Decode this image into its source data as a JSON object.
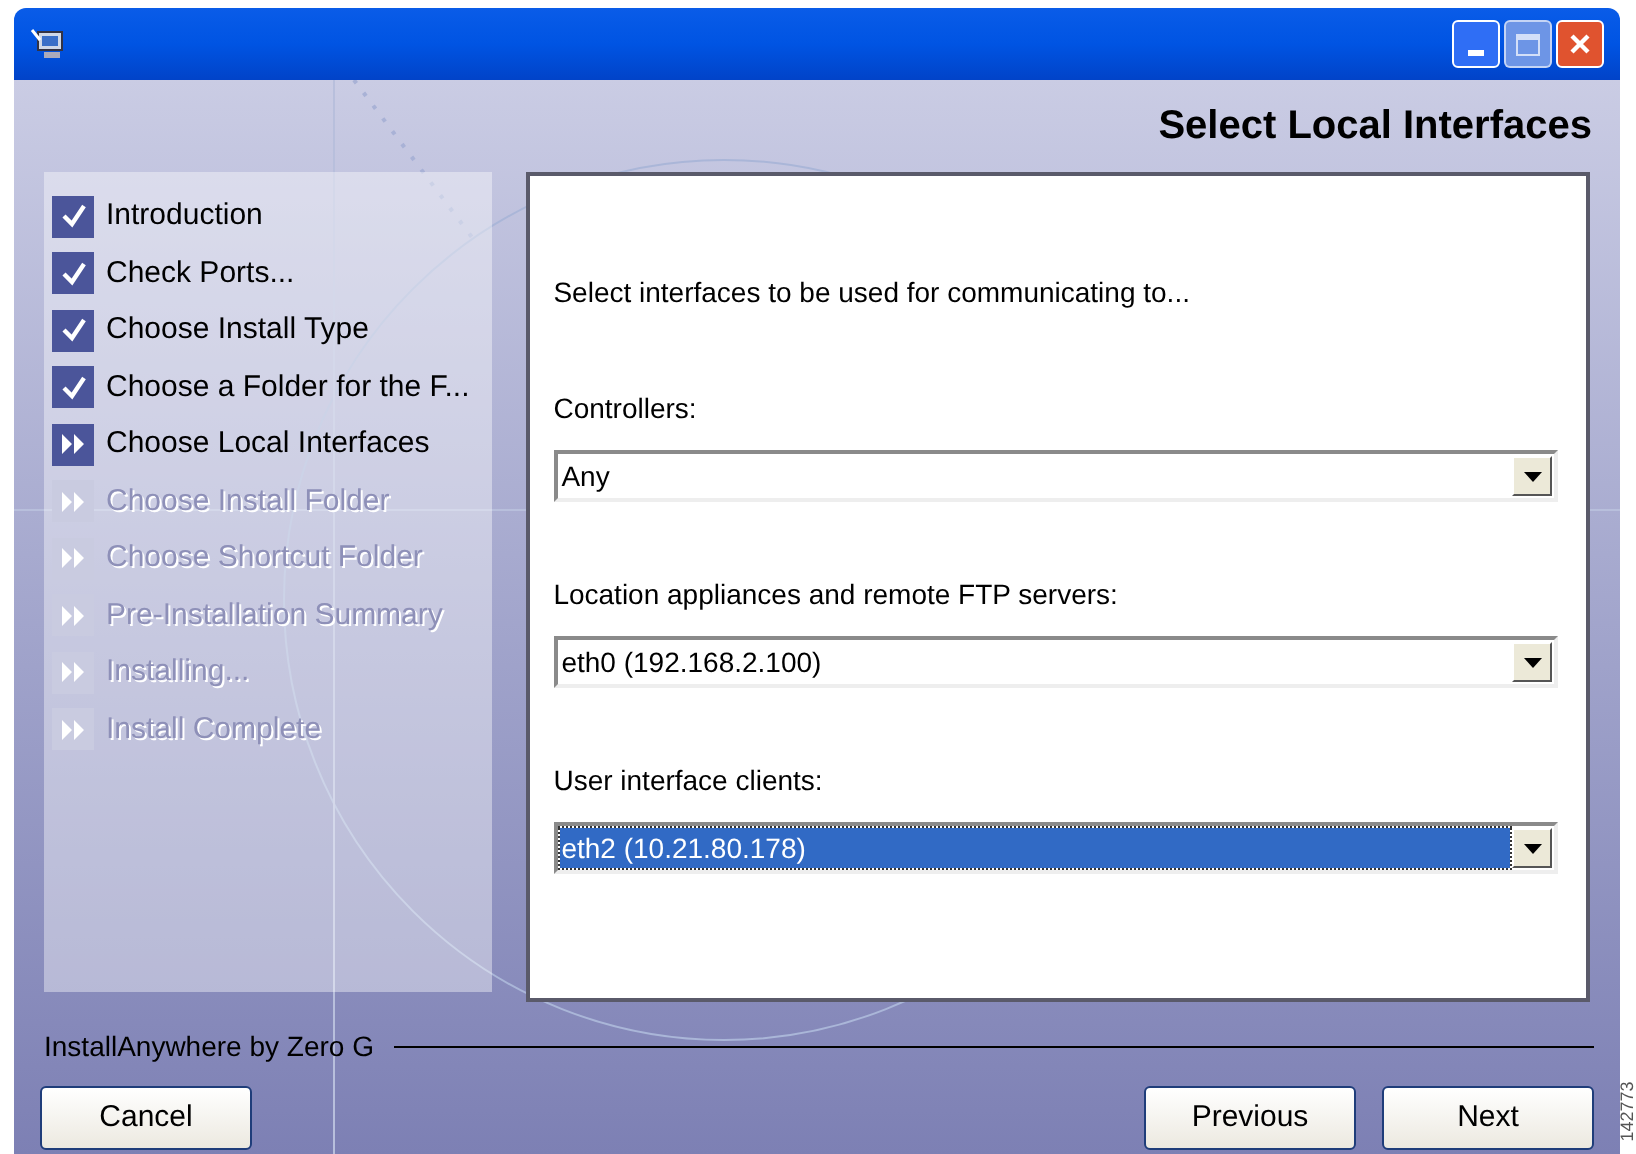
{
  "header": "Select Local Interfaces",
  "steps": [
    {
      "label": "Introduction",
      "checked": true,
      "disabled": false
    },
    {
      "label": "Check Ports...",
      "checked": true,
      "disabled": false
    },
    {
      "label": "Choose Install Type",
      "checked": true,
      "disabled": false
    },
    {
      "label": "Choose a Folder for the F...",
      "checked": true,
      "disabled": false
    },
    {
      "label": "Choose Local Interfaces",
      "checked": false,
      "disabled": false
    },
    {
      "label": "Choose Install Folder",
      "checked": false,
      "disabled": true
    },
    {
      "label": "Choose Shortcut Folder",
      "checked": false,
      "disabled": true
    },
    {
      "label": "Pre-Installation Summary",
      "checked": false,
      "disabled": true
    },
    {
      "label": "Installing...",
      "checked": false,
      "disabled": true
    },
    {
      "label": "Install Complete",
      "checked": false,
      "disabled": true
    }
  ],
  "intro": "Select interfaces to be used for communicating to...",
  "fields": [
    {
      "label": "Controllers:",
      "value": "Any",
      "focused": false
    },
    {
      "label": "Location appliances and remote FTP servers:",
      "value": "eth0 (192.168.2.100)",
      "focused": false
    },
    {
      "label": "User interface clients:",
      "value": "eth2 (10.21.80.178)",
      "focused": true
    }
  ],
  "vendor": "InstallAnywhere by Zero G",
  "buttons": {
    "cancel": "Cancel",
    "previous": "Previous",
    "next": "Next"
  },
  "figure_id": "142773"
}
